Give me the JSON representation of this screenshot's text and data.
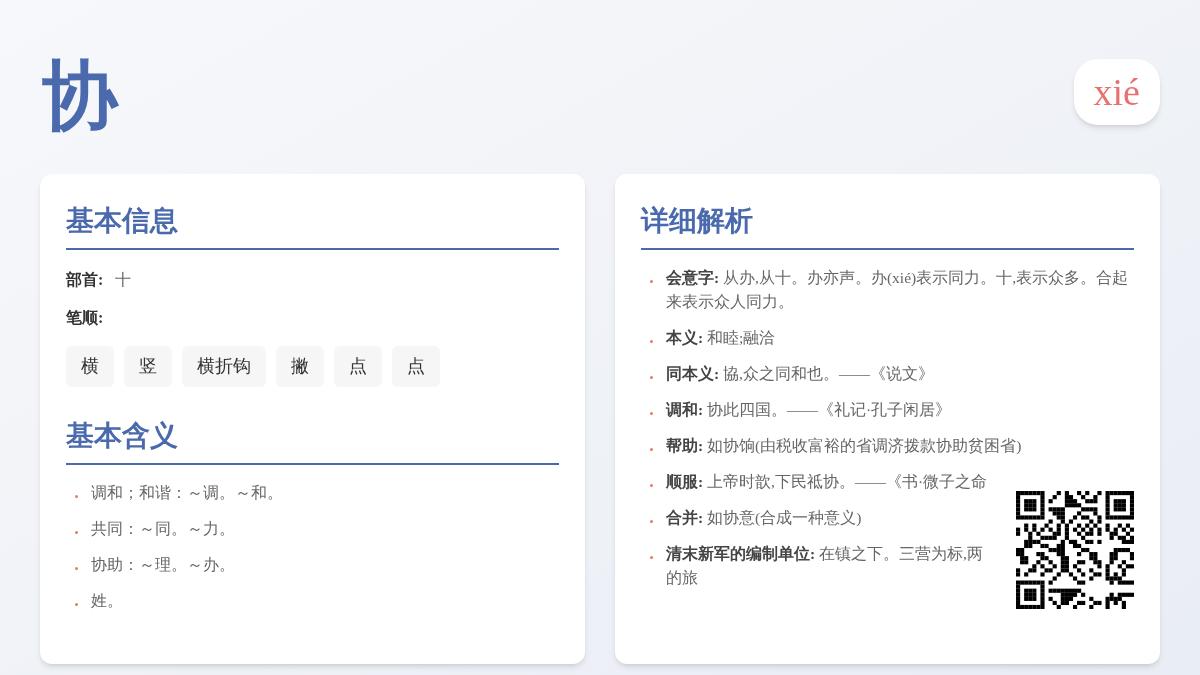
{
  "character": "协",
  "pinyin": "xié",
  "basic_info": {
    "title": "基本信息",
    "radical": {
      "label": "部首:",
      "value": "十"
    },
    "stroke_order": {
      "label": "笔顺:",
      "strokes": [
        "横",
        "竖",
        "横折钩",
        "撇",
        "点",
        "点"
      ]
    }
  },
  "basic_meanings": {
    "title": "基本含义",
    "items": [
      "调和；和谐：～调。～和。",
      "共同：～同。～力。",
      "协助：～理。～办。",
      "姓。"
    ]
  },
  "detail": {
    "title": "详细解析",
    "items": [
      {
        "term": "会意字:",
        "text": "从办,从十。办亦声。办(xié)表示同力。十,表示众多。合起来表示众人同力。"
      },
      {
        "term": "本义:",
        "text": "和睦;融洽"
      },
      {
        "term": "同本义:",
        "text": "協,众之同和也。——《说文》"
      },
      {
        "term": "调和:",
        "text": "协此四国。——《礼记·孔子闲居》"
      },
      {
        "term": "帮助:",
        "text": "如协饷(由税收富裕的省调济拨款协助贫困省)"
      },
      {
        "term": "顺服:",
        "text": "上帝时歆,下民祗协。——《书·微子之命"
      },
      {
        "term": "合并:",
        "text": "如协意(合成一种意义)"
      },
      {
        "term": "清末新军的编制单位:",
        "text": "在镇之下。三营为标,两",
        "continuation": "的旅"
      }
    ]
  }
}
